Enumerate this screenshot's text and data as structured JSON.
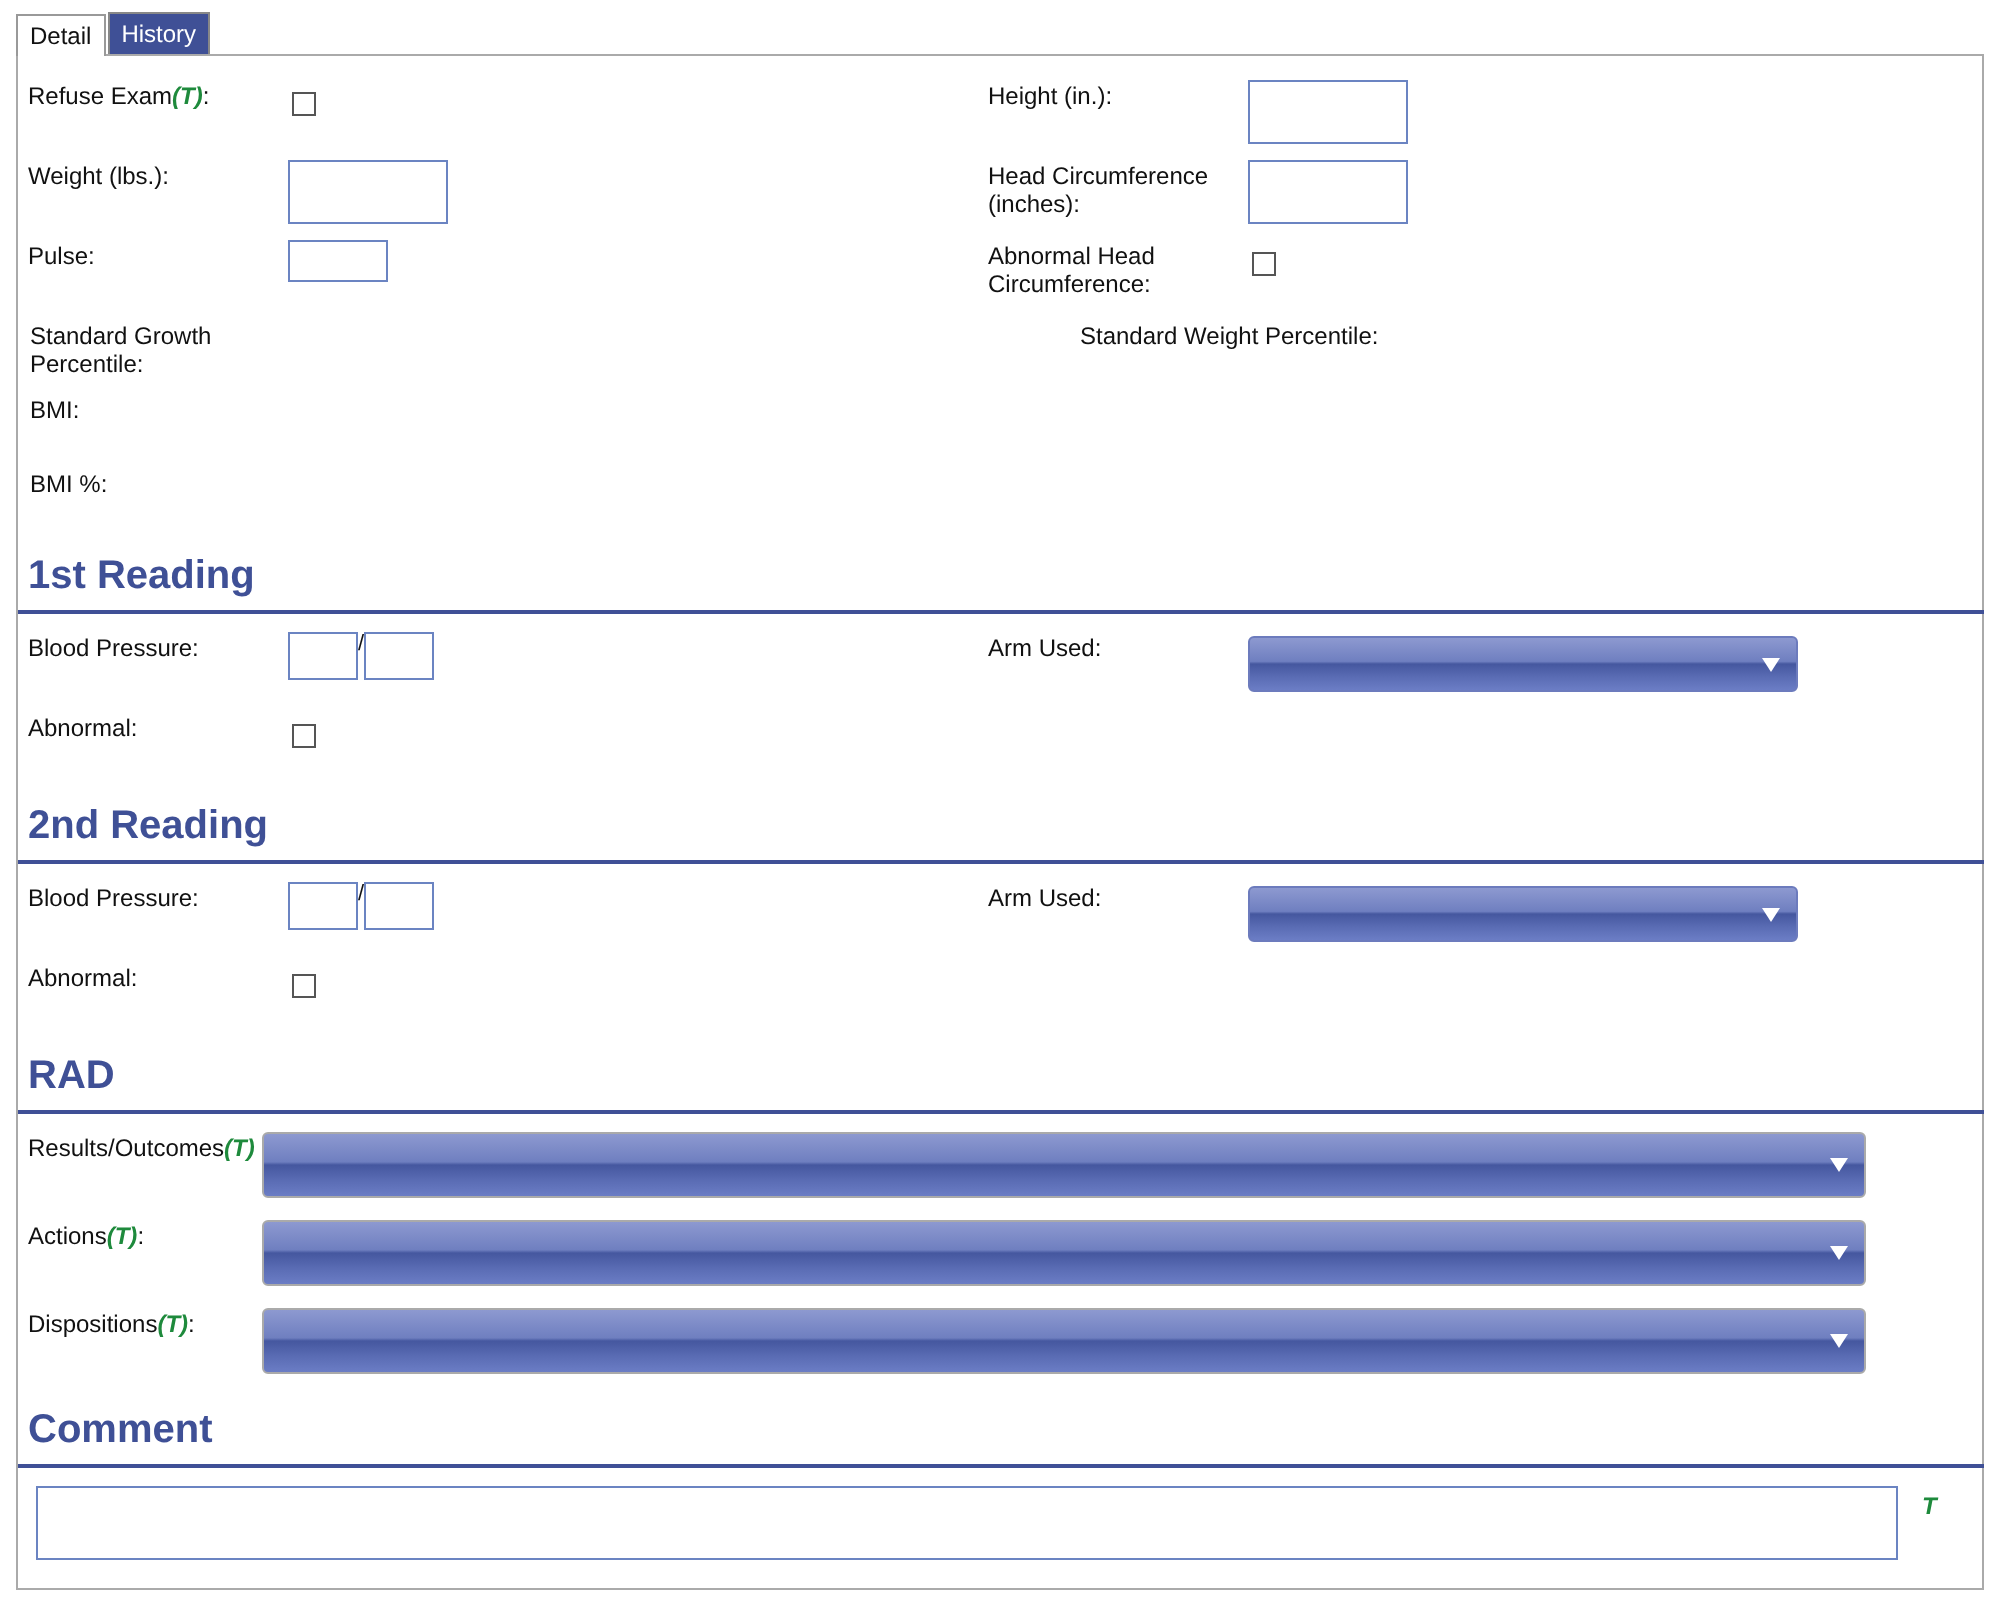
{
  "tabs": [
    {
      "label": "Detail",
      "selected": true
    },
    {
      "label": "History",
      "selected": false
    }
  ],
  "vitals": [
    [
      {
        "label": "Refuse Exam",
        "tag": "(T)",
        "suffix": ":",
        "kind": "checkbox",
        "checked": false
      },
      {
        "label": "Height (in.):",
        "kind": "textbox"
      }
    ],
    [
      {
        "label": "Weight (lbs.):",
        "kind": "textbox"
      },
      {
        "label": "Head Circumference (inches):",
        "kind": "textbox"
      }
    ],
    [
      {
        "label": "Pulse:",
        "kind": "small-textbox"
      },
      {
        "label": "Abnormal Head Circumference:",
        "kind": "checkbox",
        "checked": false
      }
    ],
    [
      {
        "label": "Standard Growth Percentile:",
        "kind": "readout"
      },
      {
        "label": "Standard Weight Percentile:",
        "kind": "readout"
      }
    ],
    [
      {
        "label": "BMI:",
        "kind": "readout"
      }
    ],
    [
      {
        "label": "BMI %:",
        "kind": "readout"
      }
    ]
  ],
  "sections": [
    {
      "title": "1st Reading",
      "rows": [
        [
          {
            "label": "Blood Pressure:",
            "kind": "pressure",
            "separator": "/"
          },
          {
            "label": "Arm Used:",
            "kind": "dropdown"
          }
        ],
        [
          {
            "label": "Abnormal:",
            "kind": "checkbox",
            "checked": false
          }
        ]
      ]
    },
    {
      "title": "2nd Reading",
      "rows": [
        [
          {
            "label": "Blood Pressure:",
            "kind": "pressure",
            "separator": "/"
          },
          {
            "label": "Arm Used:",
            "kind": "dropdown"
          }
        ],
        [
          {
            "label": "Abnormal:",
            "kind": "checkbox",
            "checked": false
          }
        ]
      ]
    }
  ],
  "rad": {
    "title": "RAD",
    "fields": [
      {
        "label": "Results/Outcomes",
        "tag": "(T)"
      },
      {
        "label": "Actions",
        "tag": "(T)",
        "suffix": ":"
      },
      {
        "label": "Dispositions",
        "tag": "(T)",
        "suffix": ":"
      }
    ]
  },
  "comment": {
    "title": "Comment",
    "mark": "T"
  }
}
